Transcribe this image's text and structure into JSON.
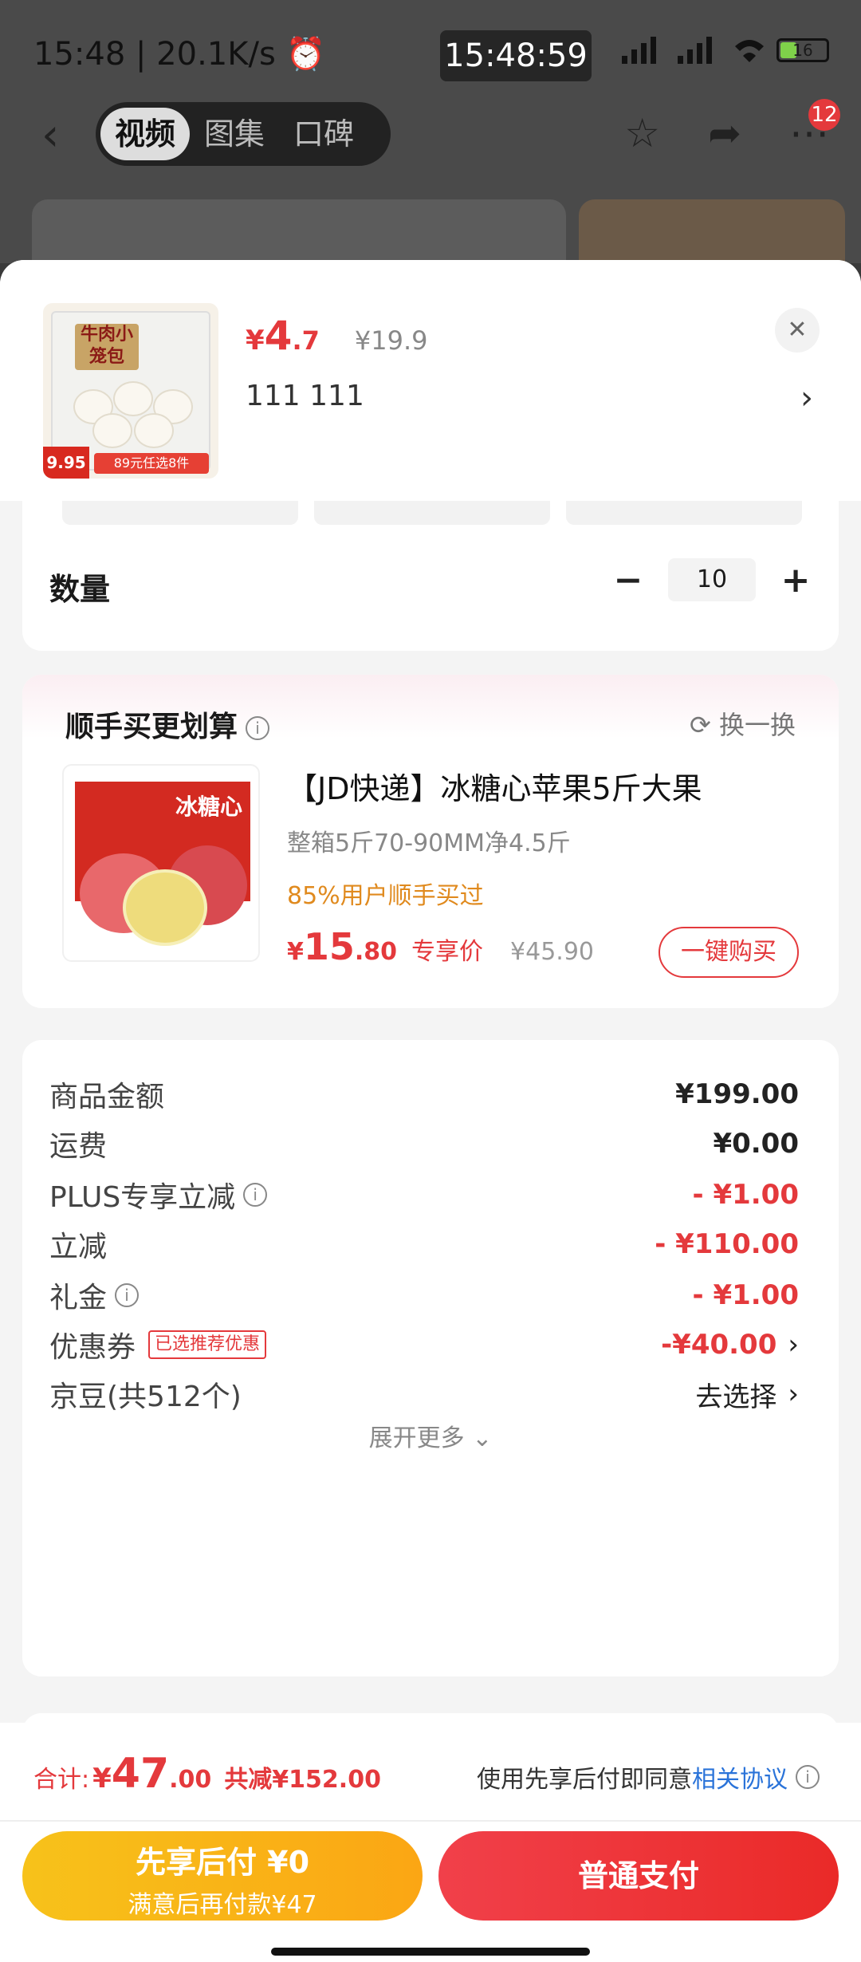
{
  "status_bar": {
    "left": "15:48 | 20.1K/s ⏰",
    "clock": "15:48:59",
    "battery": "16"
  },
  "nav": {
    "tabs": [
      {
        "label": "视频",
        "active": true
      },
      {
        "label": "图集",
        "active": false
      },
      {
        "label": "口碑",
        "active": false
      }
    ],
    "badge": "12"
  },
  "product": {
    "image_tag": "牛肉小笼包",
    "image_price": "9.95",
    "image_strip": "89元任选8件",
    "currency": "¥",
    "price_int": "4",
    "price_dec": ".7",
    "original_price": "¥19.9",
    "spec": "111  111",
    "spec_chips": [
      "",
      "",
      ""
    ]
  },
  "quantity": {
    "label": "数量",
    "value": "10",
    "minus": "−",
    "plus": "+"
  },
  "addon": {
    "title": "顺手买更划算",
    "swap_label": "换一换",
    "image_text": "冰糖心",
    "name": "【JD快递】冰糖心苹果5斤大果",
    "sub": "整箱5斤70-90MM净4.5斤",
    "percent": "85%用户顺手买过",
    "price_cur": "¥",
    "price_int": "15",
    "price_dec": ".80",
    "price_label": "专享价",
    "original": "¥45.90",
    "buy_label": "一键购买"
  },
  "summary": {
    "rows": [
      {
        "label": "商品金额",
        "value": "¥199.00"
      },
      {
        "label": "运费",
        "value": "¥0.00"
      },
      {
        "label": "PLUS专享立减",
        "value": "- ¥1.00"
      },
      {
        "label": "立减",
        "value": "- ¥110.00"
      },
      {
        "label": "礼金",
        "value": "- ¥1.00"
      },
      {
        "label": "优惠券",
        "value": "-¥40.00",
        "tag": "已选推荐优惠"
      },
      {
        "label": "京豆(共512个)",
        "value": "去选择"
      }
    ],
    "more": "展开更多 ⌄"
  },
  "footer": {
    "total_label": "合计: ",
    "currency": "¥",
    "total_int": "47",
    "total_dec": ".00",
    "saved": "共减¥152.00",
    "agree_text": "使用先享后付即同意",
    "agree_link": "相关协议",
    "pay_later_title": "先享后付 ¥0",
    "pay_later_sub": "满意后再付款¥47",
    "pay_now": "普通支付"
  },
  "colors": {
    "accent": "#e4393c",
    "link": "#2a73d9",
    "gold": "#f7c21a"
  }
}
